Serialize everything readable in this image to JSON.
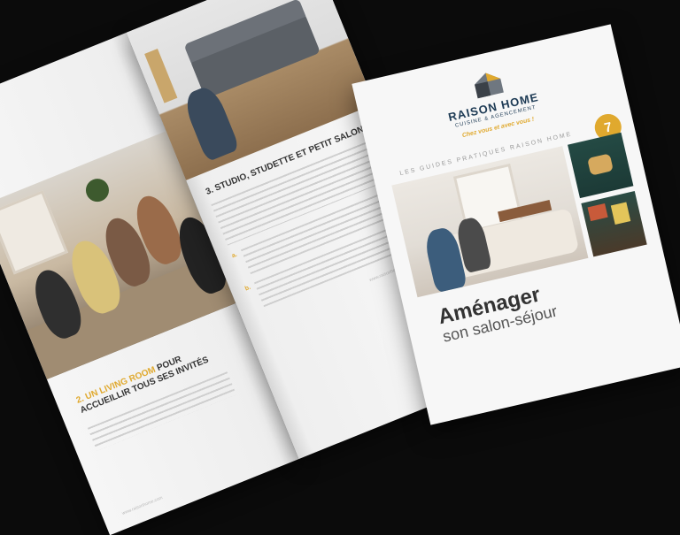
{
  "brochure_open": {
    "left_page": {
      "heading_number": "2.",
      "heading_accent": "UN LIVING ROOM",
      "heading_rest": "POUR ACCUEILLIR TOUS SES INVITÉS",
      "footer": "www.raisonhome.com"
    },
    "right_page": {
      "heading": "3. STUDIO, STUDETTE ET PETIT SALON",
      "sub_a": "a. ",
      "sub_b": "b. ",
      "footer": "www.raisonhome.com"
    }
  },
  "cover": {
    "brand": "RAISON HOME",
    "brand_sub": "CUISINE & AGENCEMENT",
    "tagline": "Chez vous et avec vous !",
    "series": "LES GUIDES PRATIQUES RAISON HOME",
    "badge_number": "7",
    "title_main": "Aménager",
    "title_sub": "son salon-séjour"
  },
  "colors": {
    "accent": "#e0a92e",
    "brand_blue": "#1e3b55",
    "background": "#0b0b0b"
  }
}
